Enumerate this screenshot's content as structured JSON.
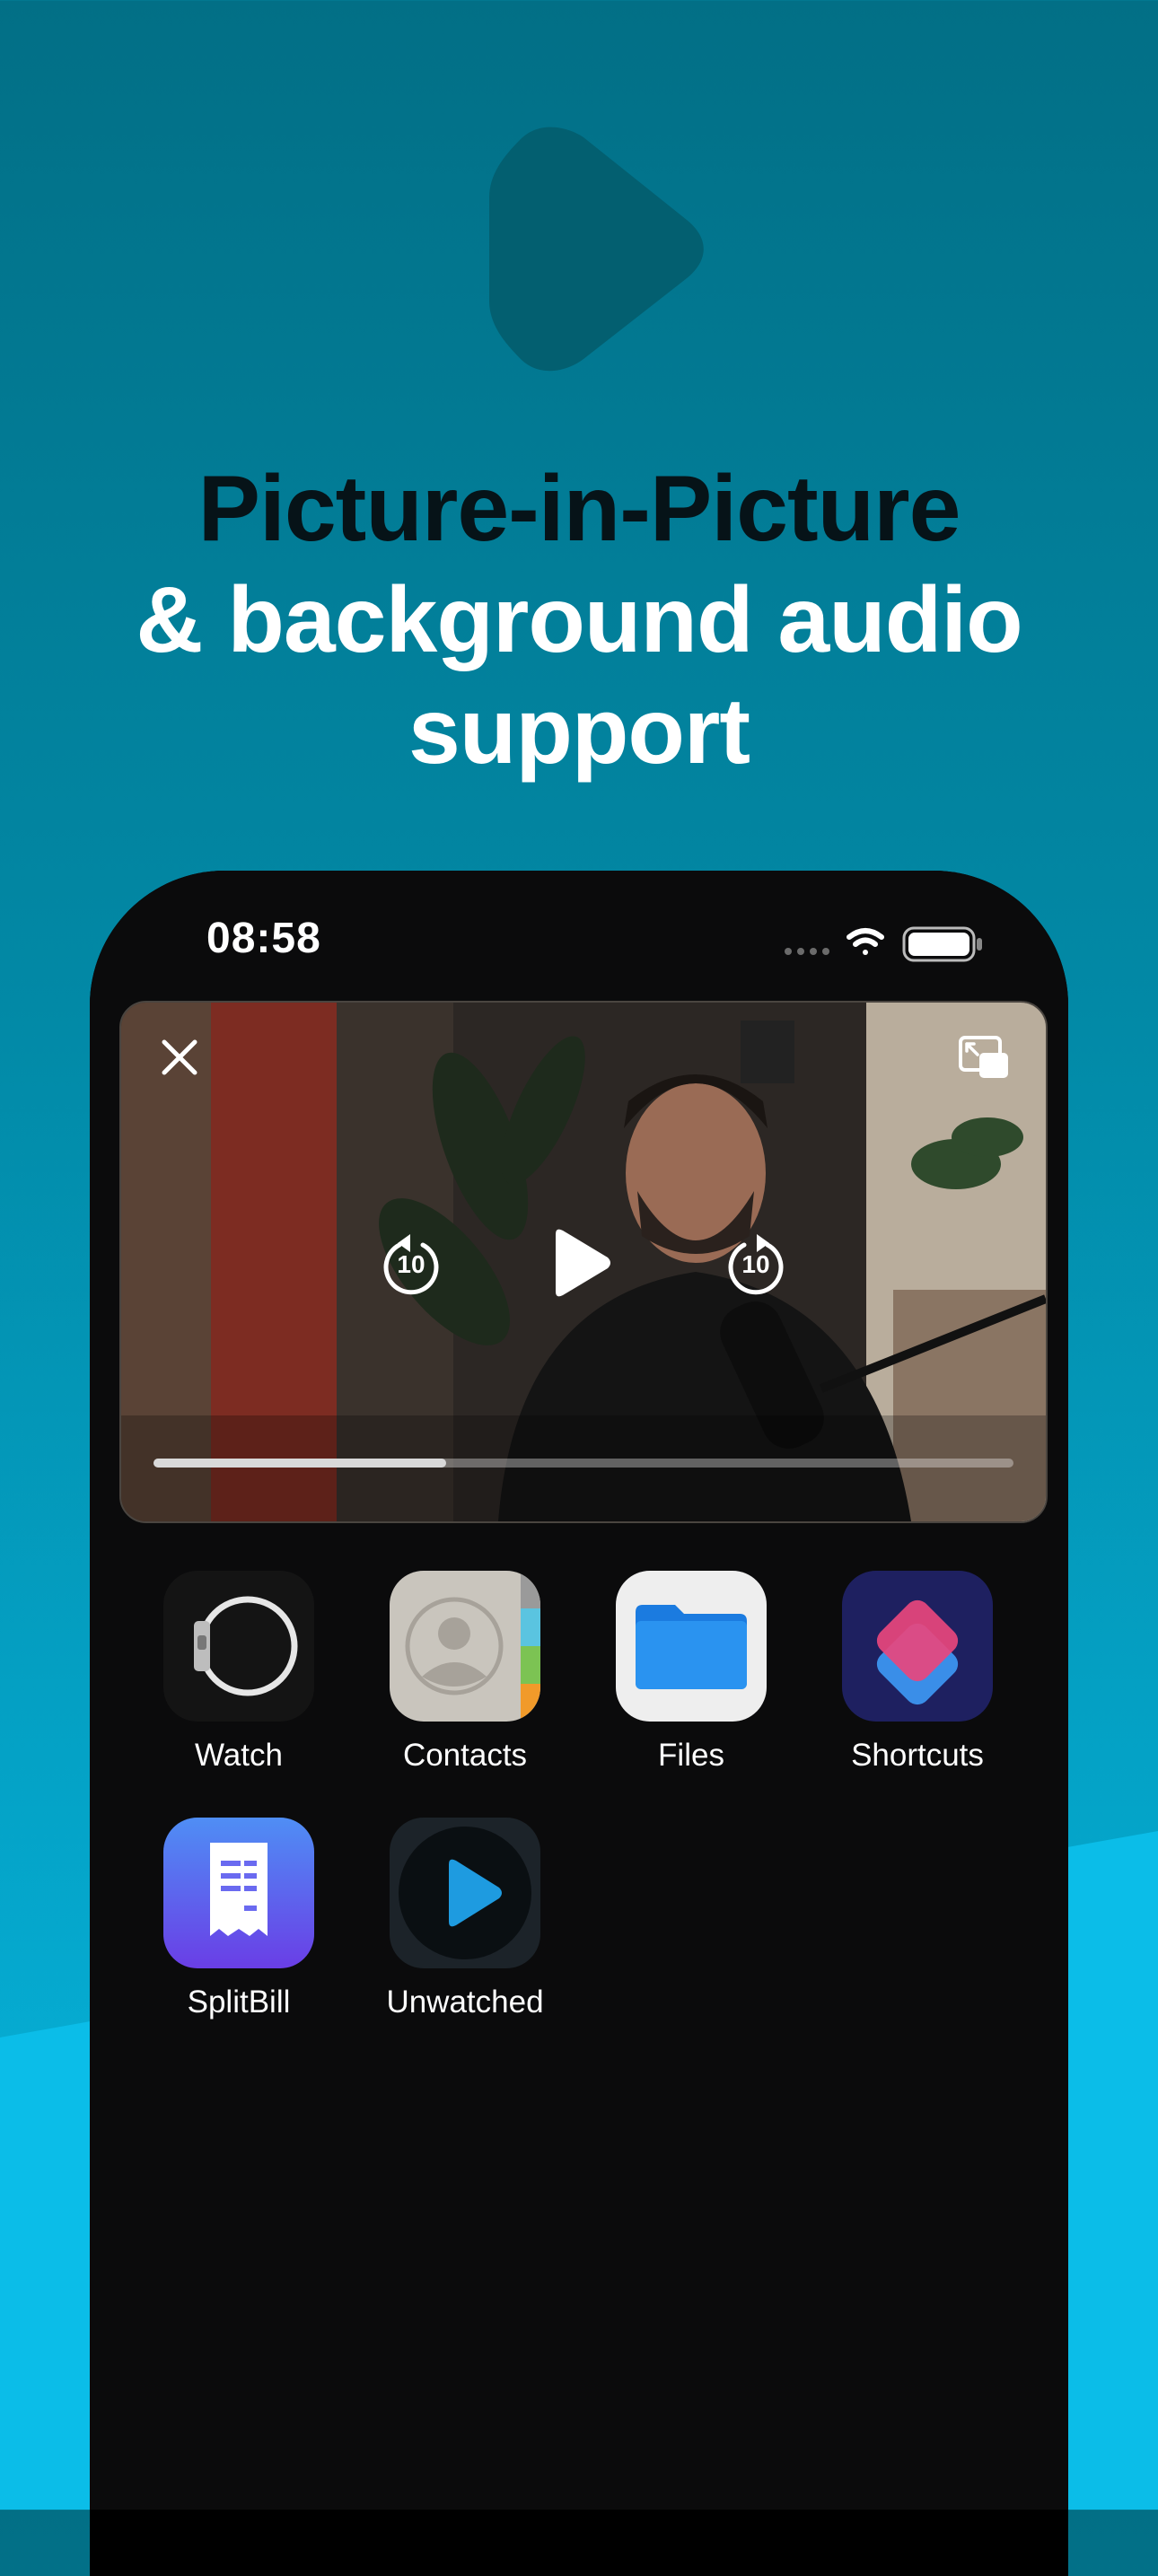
{
  "headline": {
    "line1": "Picture-in-Picture",
    "line2": "& background audio",
    "line3": "support"
  },
  "status_bar": {
    "time": "08:58",
    "icons": [
      "signal-dots-icon",
      "wifi-icon",
      "battery-icon"
    ]
  },
  "pip_player": {
    "skip_back_seconds": "10",
    "skip_forward_seconds": "10",
    "progress": 0.34,
    "controls": [
      "close-icon",
      "return-to-app-icon",
      "skip-back-10-icon",
      "play-icon",
      "skip-forward-10-icon"
    ]
  },
  "apps": [
    {
      "label": "Watch",
      "icon": "watch-app-icon"
    },
    {
      "label": "Contacts",
      "icon": "contacts-app-icon"
    },
    {
      "label": "Files",
      "icon": "files-app-icon"
    },
    {
      "label": "Shortcuts",
      "icon": "shortcuts-app-icon"
    },
    {
      "label": "SplitBill",
      "icon": "splitbill-app-icon"
    },
    {
      "label": "Unwatched",
      "icon": "unwatched-app-icon"
    }
  ],
  "colors": {
    "background_top": "#026f86",
    "background_bottom": "#08b8e2",
    "headline_dark": "#061318",
    "accent_blue": "#1e9be0"
  }
}
